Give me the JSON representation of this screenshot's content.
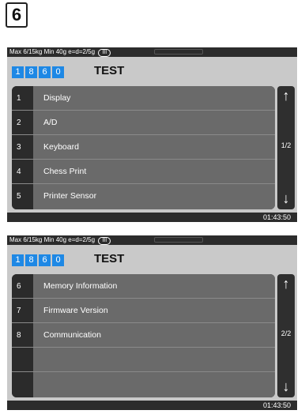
{
  "step": "6",
  "screens": [
    {
      "spec": "Max 6/15kg Min 40g e=d=2/5g",
      "class_mark": "III",
      "code": [
        "1",
        "8",
        "6",
        "0"
      ],
      "title": "TEST",
      "items": [
        {
          "num": "1",
          "label": "Display"
        },
        {
          "num": "2",
          "label": "A/D"
        },
        {
          "num": "3",
          "label": "Keyboard"
        },
        {
          "num": "4",
          "label": "Chess Print"
        },
        {
          "num": "5",
          "label": "Printer Sensor"
        }
      ],
      "page": "1/2",
      "time": "01:43:50"
    },
    {
      "spec": "Max 6/15kg Min 40g e=d=2/5g",
      "class_mark": "III",
      "code": [
        "1",
        "8",
        "6",
        "0"
      ],
      "title": "TEST",
      "items": [
        {
          "num": "6",
          "label": "Memory Information"
        },
        {
          "num": "7",
          "label": "Firmware Version"
        },
        {
          "num": "8",
          "label": "Communication"
        },
        {
          "num": "",
          "label": ""
        },
        {
          "num": "",
          "label": ""
        }
      ],
      "page": "2/2",
      "time": "01:43:50"
    }
  ],
  "icons": {
    "up": "arrow-up-icon",
    "down": "arrow-down-icon"
  },
  "colors": {
    "code_digit": "#1e88e5",
    "row": "#6a6a6a",
    "frame": "#2c2c2c"
  }
}
